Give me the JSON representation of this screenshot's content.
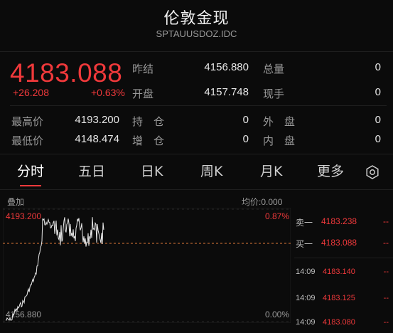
{
  "header": {
    "title": "伦敦金现",
    "code": "SPTAUUSDOZ.IDC"
  },
  "quote": {
    "price": "4183.088",
    "change": "+26.208",
    "change_pct": "+0.63%",
    "stats": [
      {
        "label": "昨结",
        "value": "4156.880"
      },
      {
        "label": "总量",
        "value": "0"
      },
      {
        "label": "开盘",
        "value": "4157.748"
      },
      {
        "label": "现手",
        "value": "0"
      },
      {
        "label": "最高价",
        "value": "4193.200"
      },
      {
        "label": "持　仓",
        "value": "0"
      },
      {
        "label": "外　盘",
        "value": "0"
      },
      {
        "label": "最低价",
        "value": "4148.474"
      },
      {
        "label": "增　仓",
        "value": "0"
      },
      {
        "label": "内　盘",
        "value": "0"
      }
    ]
  },
  "tabs": [
    "分时",
    "五日",
    "日K",
    "周K",
    "月K",
    "更多"
  ],
  "active_tab": "分时",
  "chart": {
    "overlay_label": "叠加",
    "avg_label": "均价:0.000",
    "top_price": "4193.200",
    "bottom_price": "4156.880",
    "top_pct": "0.87%",
    "bottom_pct": "0.00%"
  },
  "orderbook": {
    "ask": {
      "label": "卖一",
      "price": "4183.238",
      "qty": "--"
    },
    "bid": {
      "label": "买一",
      "price": "4183.088",
      "qty": "--"
    }
  },
  "ticks": [
    {
      "time": "14:09",
      "price": "4183.140",
      "qty": "--"
    },
    {
      "time": "14:09",
      "price": "4183.125",
      "qty": "--"
    },
    {
      "time": "14:09",
      "price": "4183.080",
      "qty": "--"
    }
  ],
  "colors": {
    "up": "#f0393b",
    "background": "#0b0b0b",
    "line": "#e8e8e8",
    "ref_line": "#e07a3a"
  }
}
